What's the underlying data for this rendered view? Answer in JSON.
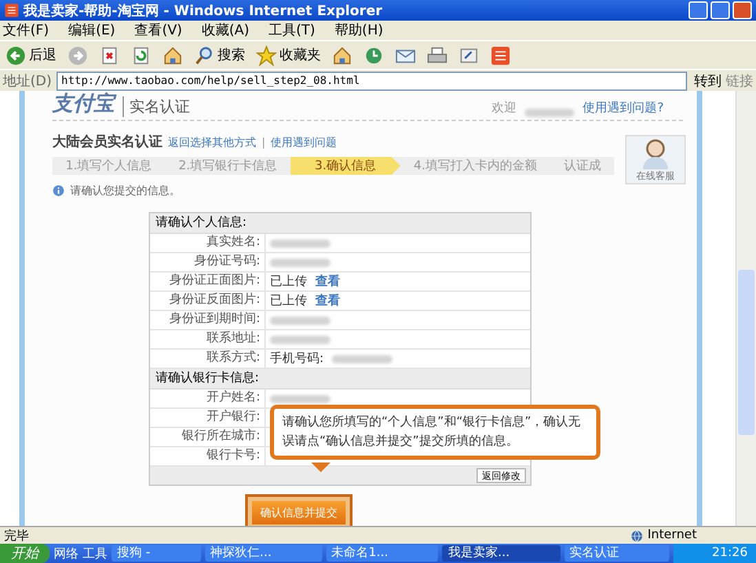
{
  "window": {
    "title": "我是卖家-帮助-淘宝网 - Windows Internet Explorer"
  },
  "menu": [
    "文件(F)",
    "编辑(E)",
    "查看(V)",
    "收藏(A)",
    "工具(T)",
    "帮助(H)"
  ],
  "toolbar": [
    {
      "kind": "back",
      "label": "后退"
    },
    {
      "kind": "forward"
    },
    {
      "kind": "stop"
    },
    {
      "kind": "refresh"
    },
    {
      "kind": "home"
    },
    {
      "kind": "search",
      "label": "搜索"
    },
    {
      "kind": "favorites",
      "label": "收藏夹"
    },
    {
      "kind": "home"
    },
    {
      "kind": "history"
    },
    {
      "kind": "mail"
    },
    {
      "kind": "print"
    },
    {
      "kind": "edit"
    },
    {
      "kind": "app"
    }
  ],
  "address": {
    "label": "地址(D)",
    "url": "http://www.taobao.com/help/sell_step2_08.html",
    "go": "转到",
    "links": "链接"
  },
  "page": {
    "logo": "支付宝",
    "section": "实名认证",
    "welcome": "欢迎",
    "help_link": "使用遇到问题?",
    "heading": "大陆会员实名认证",
    "links": [
      "返回选择其他方式",
      "使用遇到问题"
    ],
    "link_separator": "|",
    "steps": [
      {
        "label": "1.填写个人信息",
        "selected": false
      },
      {
        "label": "2.填写银行卡信息",
        "selected": false
      },
      {
        "label": "3.确认信息",
        "selected": true
      },
      {
        "label": "4.填写打入卡内的金额",
        "selected": false
      },
      {
        "label": "认证成",
        "selected": false
      }
    ],
    "service": "在线客服",
    "notice": "请确认您提交的信息。",
    "groups": [
      {
        "title": "请确认个人信息:",
        "rows": [
          {
            "label": "真实姓名:",
            "redacted": true
          },
          {
            "label": "身份证号码:",
            "redacted": true
          },
          {
            "label": "身份证正面图片:",
            "value": "已上传",
            "link": "查看",
            "redacted": false
          },
          {
            "label": "身份证反面图片:",
            "value": "已上传",
            "link": "查看",
            "redacted": false
          },
          {
            "label": "身份证到期时间:",
            "redacted": true
          },
          {
            "label": "联系地址:",
            "redacted": true
          },
          {
            "label": "联系方式:",
            "value": "手机号码:",
            "redacted": true
          }
        ]
      },
      {
        "title": "请确认银行卡信息:",
        "rows": [
          {
            "label": "开户姓名:",
            "redacted": true
          },
          {
            "label": "开户银行:",
            "redacted": false
          },
          {
            "label": "银行所在城市:",
            "redacted": false
          },
          {
            "label": "银行卡号:",
            "redacted": false
          }
        ],
        "footer": "返回修改"
      }
    ],
    "callout": "请确认您所填写的“个人信息”和“银行卡信息”，确认无误请点“确认信息并提交”提交所填的信息。",
    "submit": "确认信息并提交"
  },
  "status": {
    "text": "完毕",
    "zone": "Internet"
  },
  "taskbar": {
    "start": "开始",
    "toolbars": [
      "网络",
      "工具"
    ],
    "items": [
      {
        "label": "搜狗 -",
        "selected": false
      },
      {
        "label": "神探狄仁...",
        "selected": false
      },
      {
        "label": "未命名1...",
        "selected": false
      },
      {
        "label": "我是卖家...",
        "selected": true
      },
      {
        "label": "实名认证",
        "selected": false
      }
    ],
    "clock": "21:26"
  }
}
